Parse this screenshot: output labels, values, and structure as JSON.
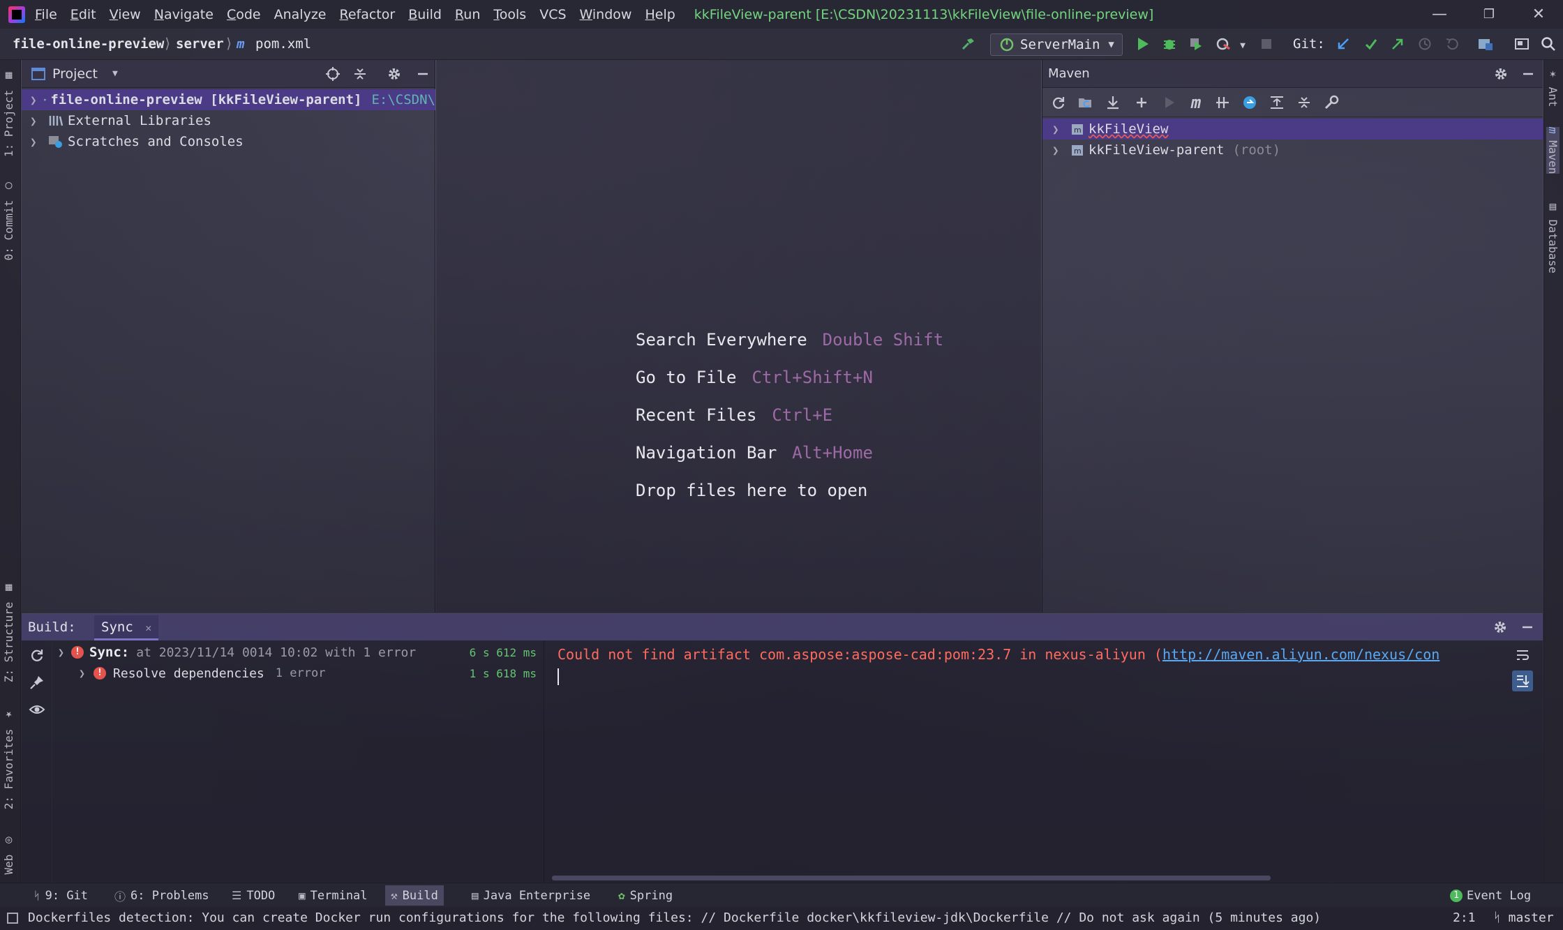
{
  "window": {
    "title": "kkFileView-parent [E:\\CSDN\\20231113\\kkFileView\\file-online-preview]",
    "controls": [
      "minimize-icon",
      "restore-icon",
      "close-icon"
    ]
  },
  "menu": [
    {
      "mnemonic": "F",
      "rest": "ile"
    },
    {
      "mnemonic": "E",
      "rest": "dit"
    },
    {
      "mnemonic": "V",
      "rest": "iew"
    },
    {
      "mnemonic": "N",
      "rest": "avigate"
    },
    {
      "mnemonic": "C",
      "rest": "ode"
    },
    {
      "mnemonic": "",
      "rest": "Analyze"
    },
    {
      "mnemonic": "R",
      "rest": "efactor"
    },
    {
      "mnemonic": "B",
      "rest": "uild"
    },
    {
      "mnemonic": "R",
      "rest": "un"
    },
    {
      "mnemonic": "T",
      "rest": "ools"
    },
    {
      "mnemonic": "",
      "rest": "VCS"
    },
    {
      "mnemonic": "W",
      "rest": "indow"
    },
    {
      "mnemonic": "H",
      "rest": "elp"
    }
  ],
  "breadcrumb": {
    "project": "file-online-preview",
    "module": "server",
    "file": "pom.xml",
    "file_icon": "m"
  },
  "toolbar": {
    "run_config": "ServerMain",
    "git_label": "Git:"
  },
  "left_tabs": {
    "project": "1: Project",
    "commit": "0: Commit",
    "structure": "Z: Structure",
    "favorites": "2: Favorites",
    "web": "Web"
  },
  "right_tabs": {
    "ant": "Ant",
    "maven": "Maven",
    "database": "Database"
  },
  "project_panel": {
    "title": "Project",
    "items": [
      {
        "label": "file-online-preview [kkFileView-parent]",
        "path": "E:\\CSDN\\",
        "selected": true
      },
      {
        "label": "External Libraries"
      },
      {
        "label": "Scratches and Consoles"
      }
    ]
  },
  "editor_hints": [
    {
      "action": "Search Everywhere",
      "key": "Double Shift"
    },
    {
      "action": "Go to File",
      "key": "Ctrl+Shift+N"
    },
    {
      "action": "Recent Files",
      "key": "Ctrl+E"
    },
    {
      "action": "Navigation Bar",
      "key": "Alt+Home"
    },
    {
      "action": "Drop files here to open",
      "key": ""
    }
  ],
  "maven_panel": {
    "title": "Maven",
    "items": [
      {
        "label": "kkFileView",
        "suffix": "",
        "selected": true
      },
      {
        "label": "kkFileView-parent",
        "suffix": "(root)"
      }
    ]
  },
  "build_panel": {
    "label": "Build:",
    "tab": "Sync",
    "rows": [
      {
        "bold": "Sync:",
        "text": "at 2023/11/14 0014 10:02 with 1 error",
        "time": "6 s 612 ms"
      },
      {
        "bold": "",
        "text": "Resolve dependencies",
        "count": "1 error",
        "time": "1 s 618 ms"
      }
    ],
    "console": {
      "error": "Could not find artifact com.aspose:aspose-cad:pom:23.7 in nexus-aliyun (",
      "link": "http://maven.aliyun.com/nexus/con"
    }
  },
  "tool_windows": [
    {
      "label": "9: Git",
      "icon": "git-branch-icon"
    },
    {
      "label": "6: Problems",
      "icon": "info-icon"
    },
    {
      "label": "TODO",
      "icon": "list-icon"
    },
    {
      "label": "Terminal",
      "icon": "terminal-icon"
    },
    {
      "label": "Build",
      "icon": "hammer-icon",
      "active": true
    },
    {
      "label": "Java Enterprise",
      "icon": "enterprise-icon"
    },
    {
      "label": "Spring",
      "icon": "spring-icon"
    }
  ],
  "event_log": {
    "label": "Event Log",
    "count": "1"
  },
  "status": {
    "message": "Dockerfiles detection: You can create Docker run configurations for the following files: // Dockerfile docker\\kkfileview-jdk\\Dockerfile // Do not ask again (5 minutes ago)",
    "position": "2:1",
    "branch": "master"
  },
  "colors": {
    "accent": "#4b3a86",
    "error": "#ff6b5e",
    "link": "#5aa8f2",
    "success": "#73d67e",
    "hint_key": "#9e6aa6"
  }
}
